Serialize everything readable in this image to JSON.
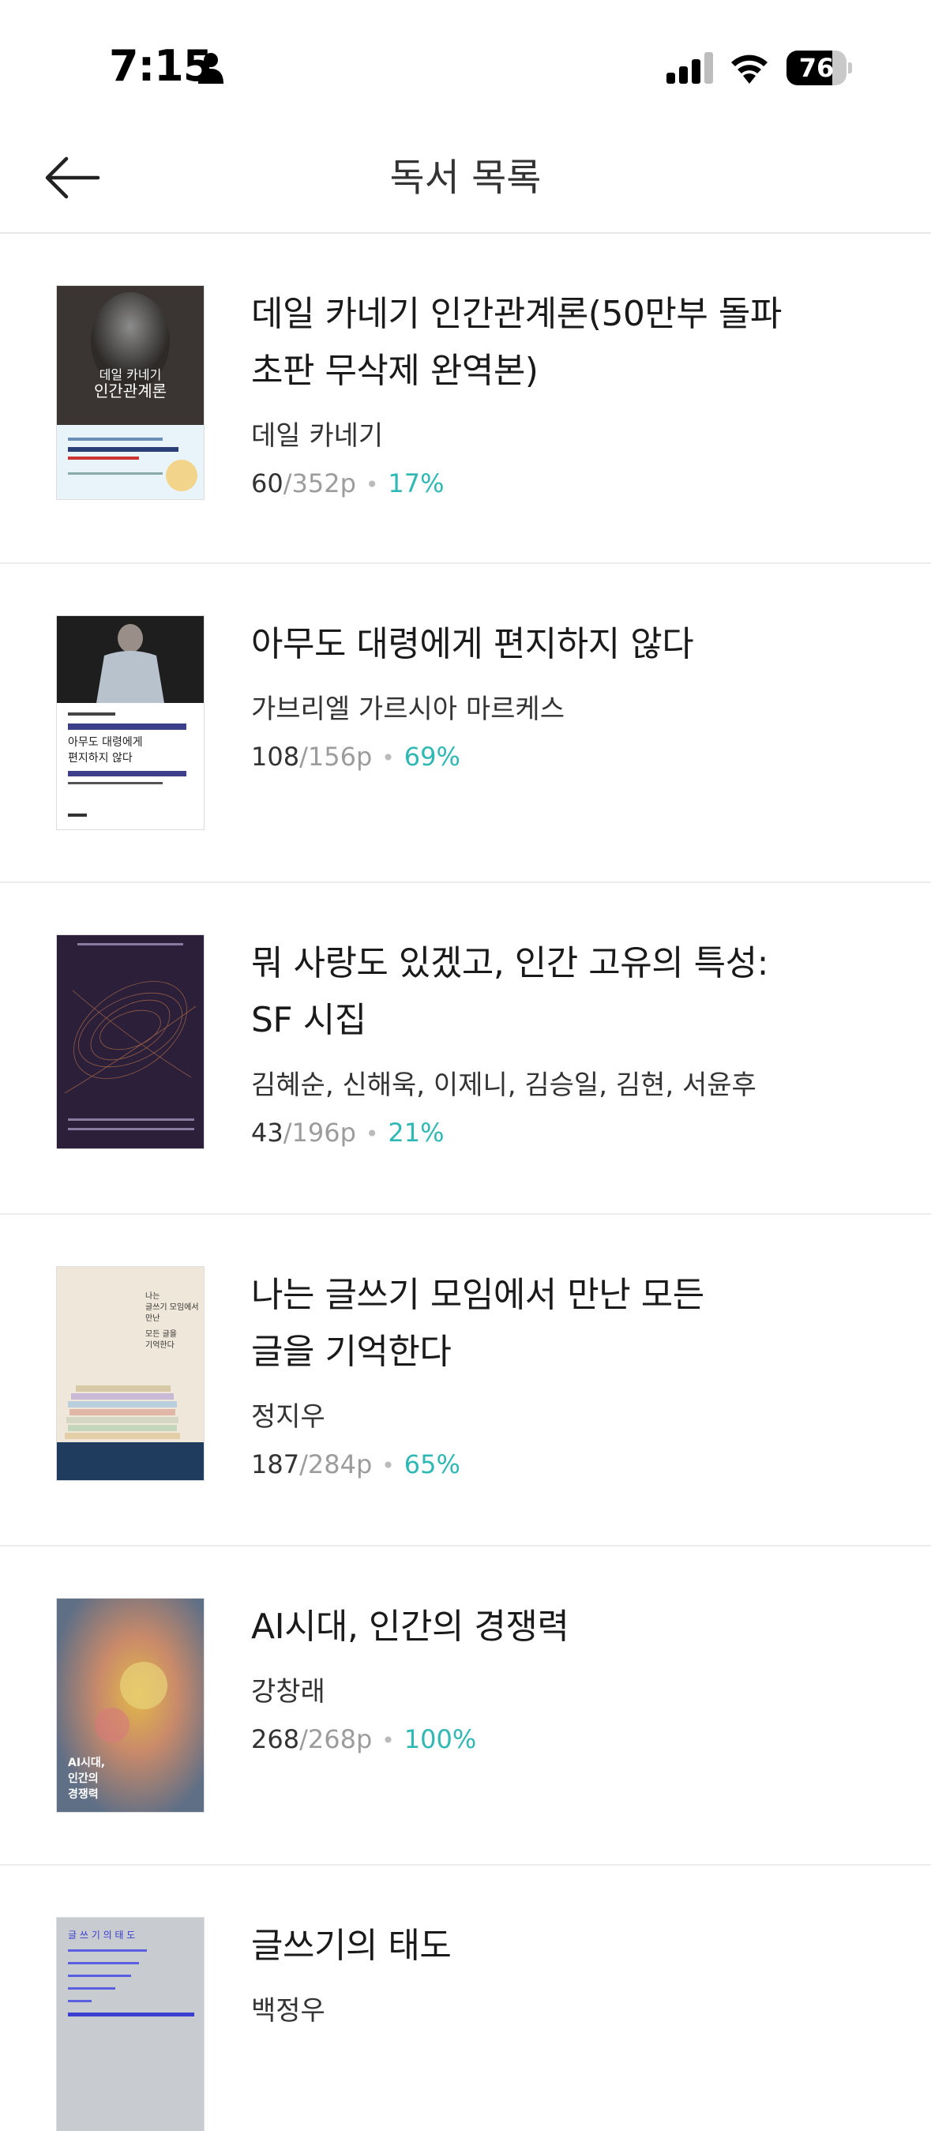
{
  "status_bar": {
    "time": "7:15",
    "battery": "76"
  },
  "nav": {
    "title": "독서 목록"
  },
  "books": [
    {
      "title_line1": "데일 카네기 인간관계론(50만부 돌파",
      "title_line2": "초판 무삭제 완역본)",
      "author": "데일 카네기",
      "current": "60",
      "total": "/352p",
      "percent": "17%",
      "cover_text": {
        "title_line1": "데일 카네기",
        "title_line2": "인간관계론"
      }
    },
    {
      "title_line1": "아무도 대령에게 편지하지 않다",
      "title_line2": "",
      "author": "가브리엘 가르시아 마르케스",
      "current": "108",
      "total": "/156p",
      "percent": "69%",
      "cover_text": {
        "title_line1": "아무도 대령에게",
        "title_line2": "편지하지 않다"
      }
    },
    {
      "title_line1": "뭐 사랑도 있겠고, 인간 고유의 특성:",
      "title_line2": "SF 시집",
      "author": "김혜순, 신해욱, 이제니, 김승일, 김현, 서윤후",
      "current": "43",
      "total": "/196p",
      "percent": "21%"
    },
    {
      "title_line1": "나는 글쓰기 모임에서 만난 모든",
      "title_line2": "글을 기억한다",
      "author": "정지우",
      "current": "187",
      "total": "/284p",
      "percent": "65%",
      "cover_text": {
        "title_line1": "나는",
        "title_line2": "글쓰기 모임에서",
        "title_line3": "만난",
        "title_line4": "모든 글을",
        "title_line5": "기억한다"
      }
    },
    {
      "title_line1": "AI시대, 인간의 경쟁력",
      "title_line2": "",
      "author": "강창래",
      "current": "268",
      "total": "/268p",
      "percent": "100%",
      "cover_text": {
        "title_line1": "AI시대,",
        "title_line2": "인간의",
        "title_line3": "경쟁력"
      }
    },
    {
      "title_line1": "글쓰기의 태도",
      "title_line2": "",
      "author": "백정우",
      "cover_text": {
        "title_line1": "글 쓰 기 의 태 도"
      }
    }
  ],
  "colors": {
    "accent": "#2fb8b4",
    "muted": "#9c9c9c"
  }
}
